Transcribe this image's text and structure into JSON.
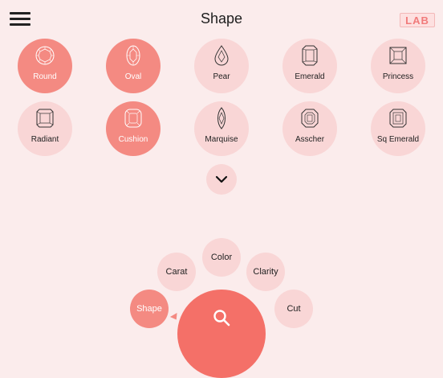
{
  "header": {
    "title": "Shape",
    "logo": "LAB"
  },
  "shapes": [
    {
      "label": "Round"
    },
    {
      "label": "Oval"
    },
    {
      "label": "Pear"
    },
    {
      "label": "Emerald"
    },
    {
      "label": "Princess"
    },
    {
      "label": "Radiant"
    },
    {
      "label": "Cushion"
    },
    {
      "label": "Marquise"
    },
    {
      "label": "Asscher"
    },
    {
      "label": "Sq Emerald"
    }
  ],
  "selected_shapes": [
    "Round",
    "Oval",
    "Cushion"
  ],
  "menu": {
    "color": "Color",
    "carat": "Carat",
    "clarity": "Clarity",
    "shape": "Shape",
    "cut": "Cut"
  },
  "colors": {
    "accent": "#f47068",
    "selected": "#f48a82",
    "bubble": "#f9d6d6",
    "background": "#fbecec"
  }
}
